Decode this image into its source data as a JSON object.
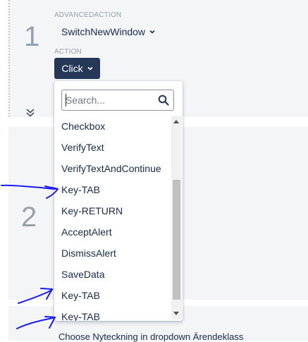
{
  "step1": {
    "number": "1",
    "advanced_action_label": "ADVANCEDACTION",
    "advanced_action_value": "SwitchNewWindow",
    "action_label": "ACTION",
    "action_value": "Click"
  },
  "step2": {
    "number": "2"
  },
  "step3": {
    "text": "Choose Nyteckning in dropdown Ärendeklass"
  },
  "dropdown": {
    "search_placeholder": "Search...",
    "search_value": "",
    "options": [
      "Checkbox",
      "VerifyText",
      "VerifyTextAndContinue",
      "Key-TAB",
      "Key-RETURN",
      "AcceptAlert",
      "DismissAlert",
      "SaveData",
      "Key-TAB",
      "Key-TAB"
    ]
  },
  "colors": {
    "action_button_bg": "#253858",
    "annotation_ink": "#1a1aff",
    "card_bg": "#f4f5f7"
  },
  "icons": [
    "chevron-down-icon",
    "search-icon",
    "double-chevron-down-icon"
  ]
}
